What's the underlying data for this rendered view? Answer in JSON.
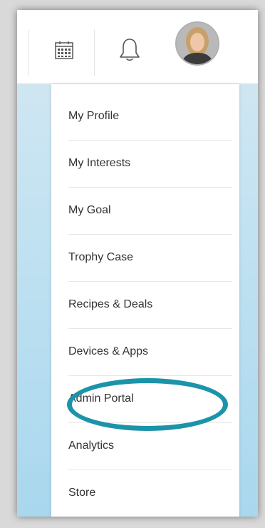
{
  "header": {
    "calendar_icon": "calendar-icon",
    "bell_icon": "bell-icon",
    "avatar_icon": "user-avatar"
  },
  "menu": {
    "items": [
      {
        "label": "My Profile"
      },
      {
        "label": "My Interests"
      },
      {
        "label": "My Goal"
      },
      {
        "label": "Trophy Case"
      },
      {
        "label": "Recipes & Deals"
      },
      {
        "label": "Devices & Apps"
      },
      {
        "label": "Admin Portal"
      },
      {
        "label": "Analytics"
      },
      {
        "label": "Store"
      }
    ]
  },
  "colors": {
    "highlight": "#1b94a9",
    "sky": "#bfe1f1"
  }
}
